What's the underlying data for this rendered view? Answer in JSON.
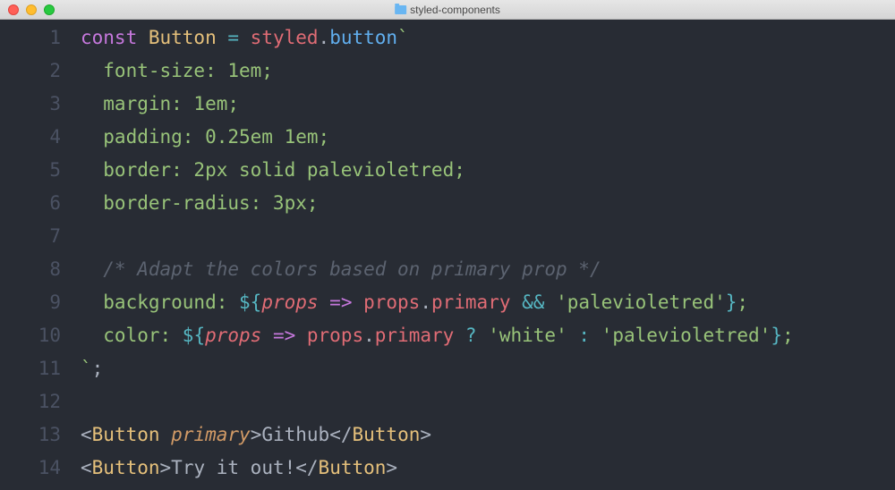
{
  "window": {
    "title": "styled-components"
  },
  "gutter": [
    "1",
    "2",
    "3",
    "4",
    "5",
    "6",
    "7",
    "8",
    "9",
    "10",
    "11",
    "12",
    "13",
    "14"
  ],
  "code": [
    [
      {
        "t": "const ",
        "c": "c-purple"
      },
      {
        "t": "Button ",
        "c": "c-yellow"
      },
      {
        "t": "= ",
        "c": "c-op"
      },
      {
        "t": "styled",
        "c": "c-red"
      },
      {
        "t": ".",
        "c": "c-gray"
      },
      {
        "t": "button",
        "c": "c-blue"
      },
      {
        "t": "`",
        "c": "c-green"
      }
    ],
    [
      {
        "t": "  font-size: 1em;",
        "c": "c-green"
      }
    ],
    [
      {
        "t": "  margin: 1em;",
        "c": "c-green"
      }
    ],
    [
      {
        "t": "  padding: 0.25em 1em;",
        "c": "c-green"
      }
    ],
    [
      {
        "t": "  border: 2px solid palevioletred;",
        "c": "c-green"
      }
    ],
    [
      {
        "t": "  border-radius: 3px;",
        "c": "c-green"
      }
    ],
    [
      {
        "t": "",
        "c": "c-green"
      }
    ],
    [
      {
        "t": "  /* Adapt the colors based on primary prop */",
        "c": "c-comment"
      }
    ],
    [
      {
        "t": "  background: ",
        "c": "c-green"
      },
      {
        "t": "${",
        "c": "c-op"
      },
      {
        "t": "props ",
        "c": "c-red ital"
      },
      {
        "t": "=>",
        "c": "c-purple"
      },
      {
        "t": " props",
        "c": "c-red"
      },
      {
        "t": ".",
        "c": "c-gray"
      },
      {
        "t": "primary ",
        "c": "c-red"
      },
      {
        "t": "&&",
        "c": "c-op"
      },
      {
        "t": " 'palevioletred'",
        "c": "c-green"
      },
      {
        "t": "}",
        "c": "c-op"
      },
      {
        "t": ";",
        "c": "c-green"
      }
    ],
    [
      {
        "t": "  color: ",
        "c": "c-green"
      },
      {
        "t": "${",
        "c": "c-op"
      },
      {
        "t": "props ",
        "c": "c-red ital"
      },
      {
        "t": "=>",
        "c": "c-purple"
      },
      {
        "t": " props",
        "c": "c-red"
      },
      {
        "t": ".",
        "c": "c-gray"
      },
      {
        "t": "primary ",
        "c": "c-red"
      },
      {
        "t": "?",
        "c": "c-op"
      },
      {
        "t": " 'white' ",
        "c": "c-green"
      },
      {
        "t": ":",
        "c": "c-op"
      },
      {
        "t": " 'palevioletred'",
        "c": "c-green"
      },
      {
        "t": "}",
        "c": "c-op"
      },
      {
        "t": ";",
        "c": "c-green"
      }
    ],
    [
      {
        "t": "`",
        "c": "c-green"
      },
      {
        "t": ";",
        "c": "c-gray"
      }
    ],
    [
      {
        "t": "",
        "c": "c-gray"
      }
    ],
    [
      {
        "t": "<",
        "c": "c-gray"
      },
      {
        "t": "Button ",
        "c": "c-yellow"
      },
      {
        "t": "primary",
        "c": "c-orange ital"
      },
      {
        "t": ">",
        "c": "c-gray"
      },
      {
        "t": "Github",
        "c": "c-gray"
      },
      {
        "t": "</",
        "c": "c-gray"
      },
      {
        "t": "Button",
        "c": "c-yellow"
      },
      {
        "t": ">",
        "c": "c-gray"
      }
    ],
    [
      {
        "t": "<",
        "c": "c-gray"
      },
      {
        "t": "Button",
        "c": "c-yellow"
      },
      {
        "t": ">",
        "c": "c-gray"
      },
      {
        "t": "Try it out!",
        "c": "c-gray"
      },
      {
        "t": "</",
        "c": "c-gray"
      },
      {
        "t": "Button",
        "c": "c-yellow"
      },
      {
        "t": ">",
        "c": "c-gray"
      }
    ]
  ]
}
